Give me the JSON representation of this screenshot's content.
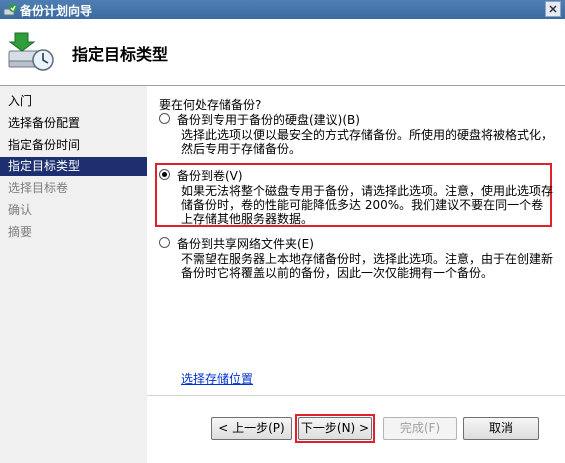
{
  "window": {
    "title": "备份计划向导",
    "header_title": "指定目标类型",
    "icons": {
      "title": "backup-wizard-icon",
      "header": "backup-disk-clock-icon",
      "close": "close-icon"
    }
  },
  "nav": {
    "items": [
      {
        "label": "入门",
        "state": "normal"
      },
      {
        "label": "选择备份配置",
        "state": "normal"
      },
      {
        "label": "指定备份时间",
        "state": "normal"
      },
      {
        "label": "指定目标类型",
        "state": "selected"
      },
      {
        "label": "选择目标卷",
        "state": "disabled"
      },
      {
        "label": "确认",
        "state": "disabled"
      },
      {
        "label": "摘要",
        "state": "disabled"
      }
    ]
  },
  "main": {
    "question": "要在何处存储备份?",
    "options": [
      {
        "label": "备份到专用于备份的硬盘(建议)(B)",
        "description": "选择此选项以便以最安全的方式存储备份。所使用的硬盘将被格式化，然后专用于存储备份。",
        "checked": false
      },
      {
        "label": "备份到卷(V)",
        "description": "如果无法将整个磁盘专用于备份，请选择此选项。注意，使用此选项存储备份时，卷的性能可能降低多达 200%。我们建议不要在同一个卷上存储其他服务器数据。",
        "checked": true
      },
      {
        "label": "备份到共享网络文件夹(E)",
        "description": "不需望在服务器上本地存储备份时，选择此选项。注意，由于在创建新备份时它将覆盖以前的备份，因此一次仅能拥有一个备份。",
        "checked": false
      }
    ],
    "link": "选择存储位置"
  },
  "footer": {
    "prev": "< 上一步(P)",
    "next": "下一步(N) >",
    "finish": "完成(F)",
    "cancel": "取消"
  },
  "colors": {
    "titlebar": "#3a6aa0",
    "nav_selected": "#1e2f6f",
    "highlight": "#e0202a",
    "link": "#0033cc"
  }
}
